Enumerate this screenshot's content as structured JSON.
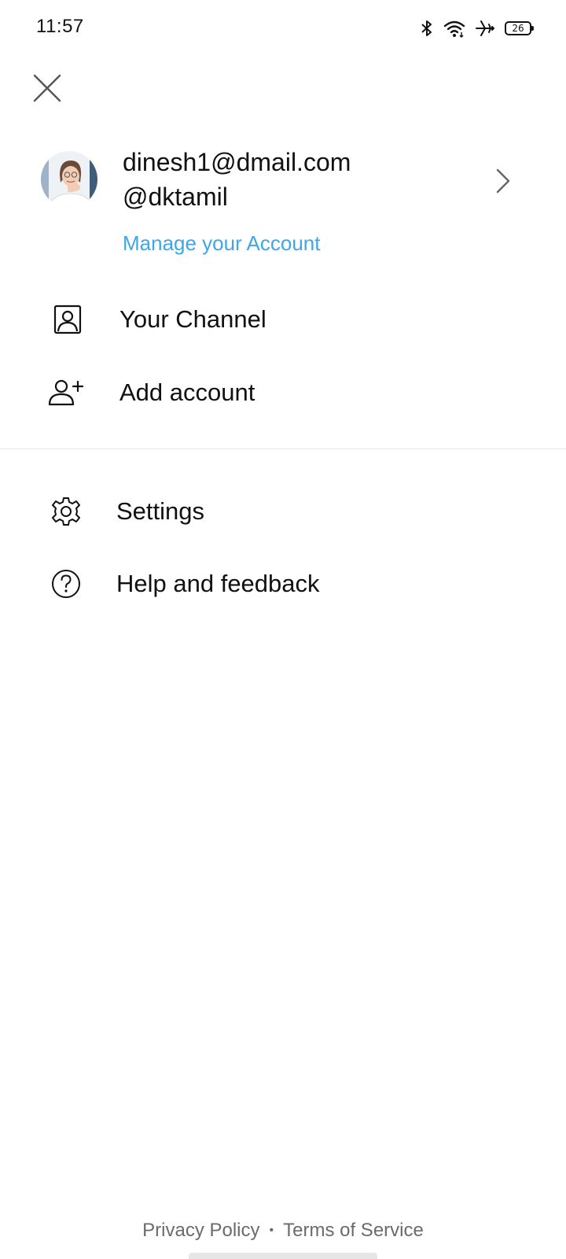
{
  "status_bar": {
    "time": "11:57",
    "battery_level": "26",
    "icons": [
      "bluetooth-icon",
      "wifi-icon",
      "airplane-mode-icon",
      "battery-icon"
    ]
  },
  "account": {
    "email": "dinesh1@dmail.com",
    "handle": "@dktamil",
    "manage_label": "Manage your Account"
  },
  "menu": {
    "section1": [
      {
        "label": "Your Channel",
        "icon": "person-box-icon"
      },
      {
        "label": "Add account",
        "icon": "add-person-icon"
      }
    ],
    "section2": [
      {
        "label": "Settings",
        "icon": "gear-icon"
      },
      {
        "label": "Help and feedback",
        "icon": "help-circle-icon"
      }
    ]
  },
  "footer": {
    "privacy": "Privacy Policy",
    "separator": "•",
    "terms": "Terms of Service"
  },
  "colors": {
    "link_blue": "#3ea6ea",
    "text": "#111111",
    "muted": "#6b6b6b"
  }
}
